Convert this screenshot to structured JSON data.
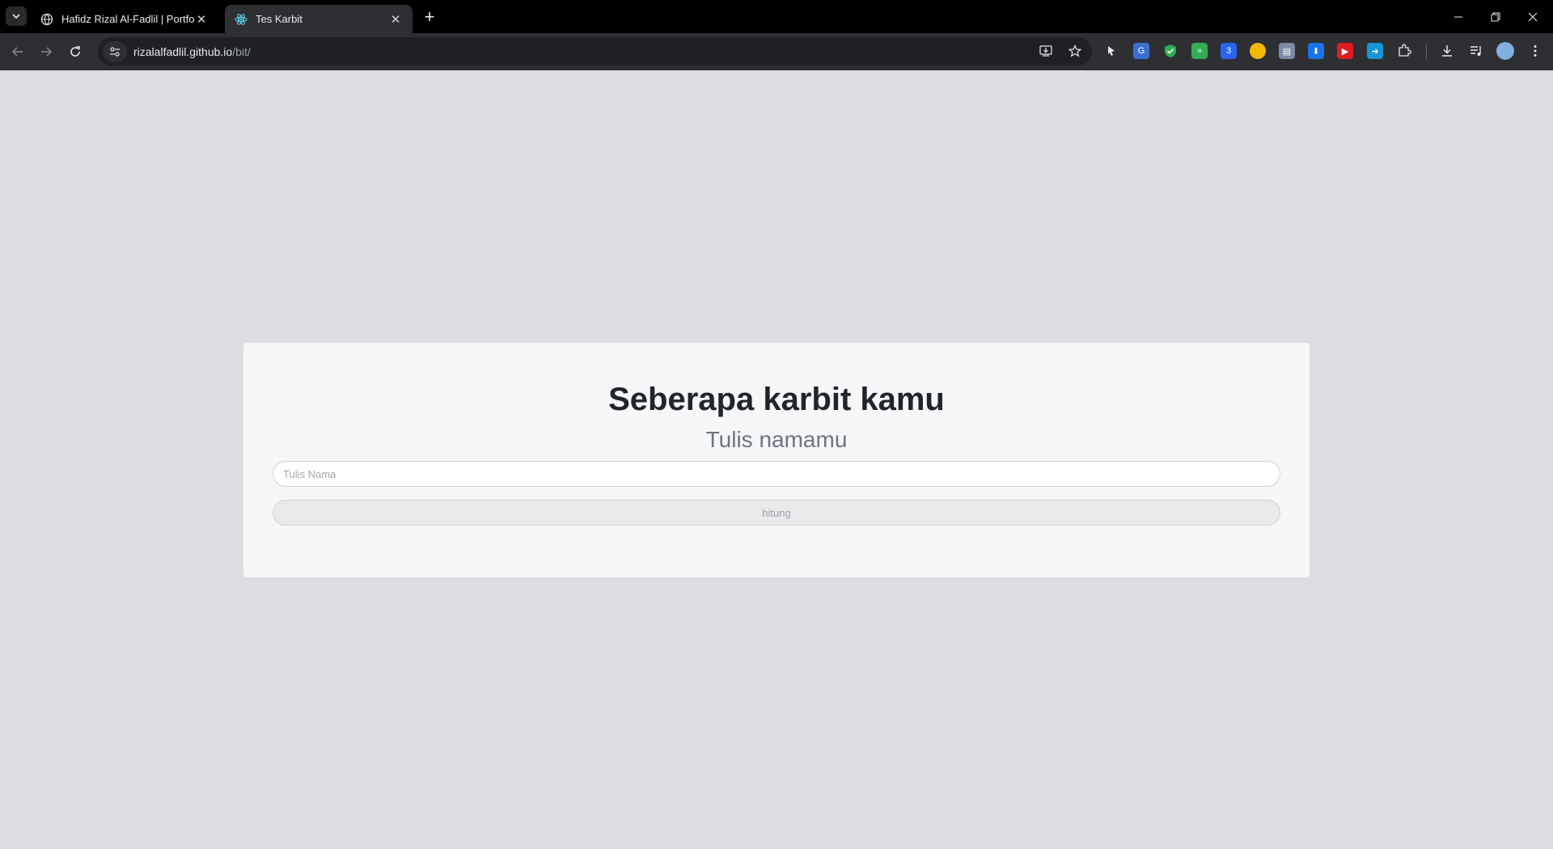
{
  "browser": {
    "tabs": [
      {
        "title": "Hafidz Rizal Al-Fadlil | Portfolio",
        "icon": "globe-icon",
        "active": false
      },
      {
        "title": "Tes Karbit",
        "icon": "react-icon",
        "active": true
      }
    ],
    "new_tab": "+",
    "url": {
      "host": "rizalalfadlil.github.io",
      "path": "/bit/"
    }
  },
  "page": {
    "heading": "Seberapa karbit kamu",
    "subheading": "Tulis namamu",
    "name_input": {
      "placeholder": "Tulis Nama",
      "value": ""
    },
    "submit_label": "hitung"
  },
  "colors": {
    "page_background": "#dcdde0",
    "card_background": "#f6f7f9",
    "browser_frame": "#000000",
    "toolbar": "#2e2f33"
  }
}
